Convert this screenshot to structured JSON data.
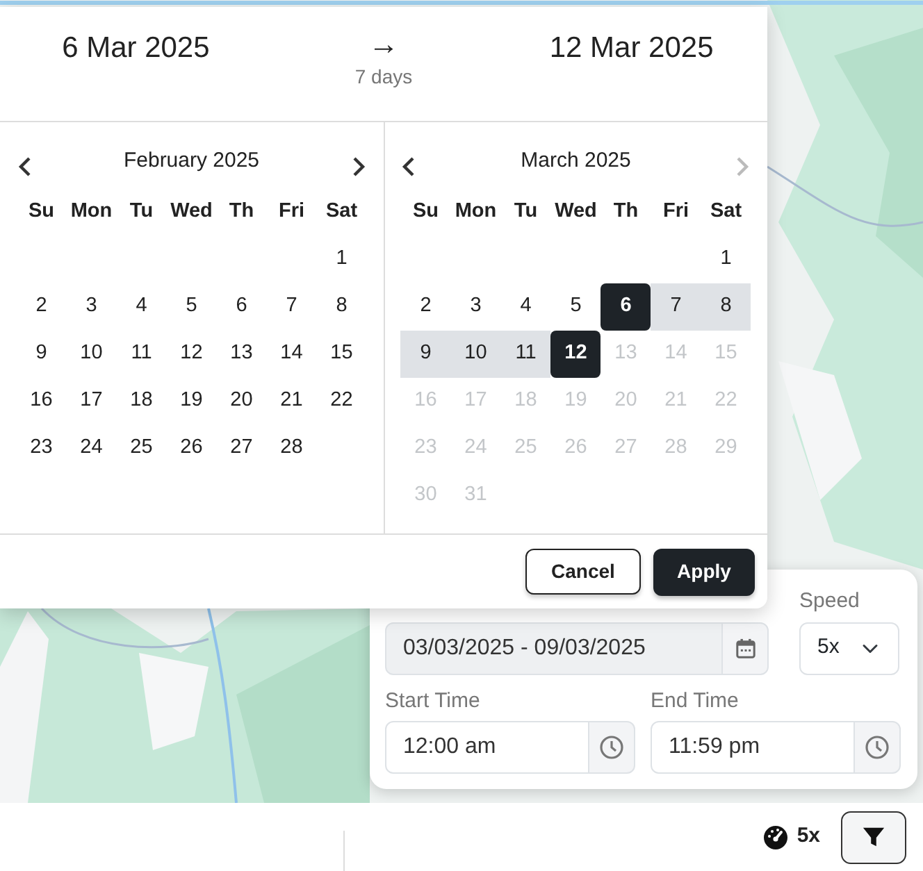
{
  "header": {
    "start": "6 Mar 2025",
    "arrow": "→",
    "end": "12 Mar 2025",
    "duration": "7 days"
  },
  "months": [
    {
      "title": "February 2025",
      "prev_disabled": false,
      "next_disabled": false,
      "weekdays": [
        "Su",
        "Mon",
        "Tu",
        "Wed",
        "Th",
        "Fri",
        "Sat"
      ],
      "weeks": [
        {
          "kind": "trailing",
          "days": [
            {
              "day": "1",
              "selected": false,
              "in_range": false,
              "disabled": false
            }
          ]
        },
        [
          {
            "day": "2",
            "selected": false,
            "in_range": false,
            "disabled": false
          },
          {
            "day": "3",
            "selected": false,
            "in_range": false,
            "disabled": false
          },
          {
            "day": "4",
            "selected": false,
            "in_range": false,
            "disabled": false
          },
          {
            "day": "5",
            "selected": false,
            "in_range": false,
            "disabled": false
          },
          {
            "day": "6",
            "selected": false,
            "in_range": false,
            "disabled": false
          },
          {
            "day": "7",
            "selected": false,
            "in_range": false,
            "disabled": false
          },
          {
            "day": "8",
            "selected": false,
            "in_range": false,
            "disabled": false
          }
        ],
        [
          {
            "day": "9",
            "selected": false,
            "in_range": false,
            "disabled": false
          },
          {
            "day": "10",
            "selected": false,
            "in_range": false,
            "disabled": false
          },
          {
            "day": "11",
            "selected": false,
            "in_range": false,
            "disabled": false
          },
          {
            "day": "12",
            "selected": false,
            "in_range": false,
            "disabled": false
          },
          {
            "day": "13",
            "selected": false,
            "in_range": false,
            "disabled": false
          },
          {
            "day": "14",
            "selected": false,
            "in_range": false,
            "disabled": false
          },
          {
            "day": "15",
            "selected": false,
            "in_range": false,
            "disabled": false
          }
        ],
        [
          {
            "day": "16",
            "selected": false,
            "in_range": false,
            "disabled": false
          },
          {
            "day": "17",
            "selected": false,
            "in_range": false,
            "disabled": false
          },
          {
            "day": "18",
            "selected": false,
            "in_range": false,
            "disabled": false
          },
          {
            "day": "19",
            "selected": false,
            "in_range": false,
            "disabled": false
          },
          {
            "day": "20",
            "selected": false,
            "in_range": false,
            "disabled": false
          },
          {
            "day": "21",
            "selected": false,
            "in_range": false,
            "disabled": false
          },
          {
            "day": "22",
            "selected": false,
            "in_range": false,
            "disabled": false
          }
        ],
        [
          {
            "day": "23",
            "selected": false,
            "in_range": false,
            "disabled": false
          },
          {
            "day": "24",
            "selected": false,
            "in_range": false,
            "disabled": false
          },
          {
            "day": "25",
            "selected": false,
            "in_range": false,
            "disabled": false
          },
          {
            "day": "26",
            "selected": false,
            "in_range": false,
            "disabled": false
          },
          {
            "day": "27",
            "selected": false,
            "in_range": false,
            "disabled": false
          },
          {
            "day": "28",
            "selected": false,
            "in_range": false,
            "disabled": false
          }
        ]
      ]
    },
    {
      "title": "March 2025",
      "prev_disabled": false,
      "next_disabled": true,
      "weekdays": [
        "Su",
        "Mon",
        "Tu",
        "Wed",
        "Th",
        "Fri",
        "Sat"
      ],
      "weeks": [
        {
          "kind": "trailing",
          "days": [
            {
              "day": "1",
              "selected": false,
              "in_range": false,
              "disabled": false
            }
          ]
        },
        [
          {
            "day": "2",
            "selected": false,
            "in_range": false,
            "disabled": false
          },
          {
            "day": "3",
            "selected": false,
            "in_range": false,
            "disabled": false
          },
          {
            "day": "4",
            "selected": false,
            "in_range": false,
            "disabled": false
          },
          {
            "day": "5",
            "selected": false,
            "in_range": false,
            "disabled": false
          },
          {
            "day": "6",
            "selected": true,
            "in_range": false,
            "disabled": false
          },
          {
            "day": "7",
            "selected": false,
            "in_range": true,
            "disabled": false
          },
          {
            "day": "8",
            "selected": false,
            "in_range": true,
            "disabled": false
          }
        ],
        [
          {
            "day": "9",
            "selected": false,
            "in_range": true,
            "disabled": false
          },
          {
            "day": "10",
            "selected": false,
            "in_range": true,
            "disabled": false
          },
          {
            "day": "11",
            "selected": false,
            "in_range": true,
            "disabled": false
          },
          {
            "day": "12",
            "selected": true,
            "in_range": false,
            "disabled": false
          },
          {
            "day": "13",
            "selected": false,
            "in_range": false,
            "disabled": true
          },
          {
            "day": "14",
            "selected": false,
            "in_range": false,
            "disabled": true
          },
          {
            "day": "15",
            "selected": false,
            "in_range": false,
            "disabled": true
          }
        ],
        [
          {
            "day": "16",
            "selected": false,
            "in_range": false,
            "disabled": true
          },
          {
            "day": "17",
            "selected": false,
            "in_range": false,
            "disabled": true
          },
          {
            "day": "18",
            "selected": false,
            "in_range": false,
            "disabled": true
          },
          {
            "day": "19",
            "selected": false,
            "in_range": false,
            "disabled": true
          },
          {
            "day": "20",
            "selected": false,
            "in_range": false,
            "disabled": true
          },
          {
            "day": "21",
            "selected": false,
            "in_range": false,
            "disabled": true
          },
          {
            "day": "22",
            "selected": false,
            "in_range": false,
            "disabled": true
          }
        ],
        [
          {
            "day": "23",
            "selected": false,
            "in_range": false,
            "disabled": true
          },
          {
            "day": "24",
            "selected": false,
            "in_range": false,
            "disabled": true
          },
          {
            "day": "25",
            "selected": false,
            "in_range": false,
            "disabled": true
          },
          {
            "day": "26",
            "selected": false,
            "in_range": false,
            "disabled": true
          },
          {
            "day": "27",
            "selected": false,
            "in_range": false,
            "disabled": true
          },
          {
            "day": "28",
            "selected": false,
            "in_range": false,
            "disabled": true
          },
          {
            "day": "29",
            "selected": false,
            "in_range": false,
            "disabled": true
          }
        ],
        [
          {
            "day": "30",
            "selected": false,
            "in_range": false,
            "disabled": true
          },
          {
            "day": "31",
            "selected": false,
            "in_range": false,
            "disabled": true
          }
        ]
      ]
    }
  ],
  "buttons": [
    {
      "label": "Cancel",
      "kind": "outline"
    },
    {
      "label": "Apply",
      "kind": "primary"
    }
  ],
  "filter_panel": {
    "date_range": {
      "value": "03/03/2025 - 09/03/2025",
      "disabled": true
    },
    "speed": {
      "label": "Speed",
      "value": "5x"
    },
    "start_time": {
      "label": "Start Time",
      "value": "12:00 am"
    },
    "end_time": {
      "label": "End Time",
      "value": "11:59 pm"
    }
  },
  "bottom_bar": {
    "speed": "5x"
  }
}
